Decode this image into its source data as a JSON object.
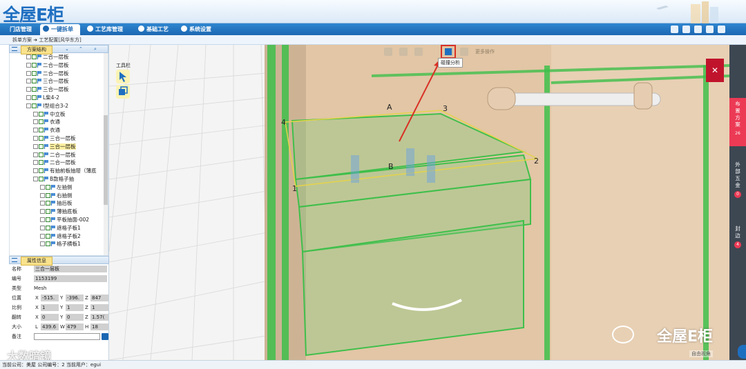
{
  "app": {
    "logo_text": "全屋E柜"
  },
  "nav": {
    "tabs": [
      {
        "label": "门店管理"
      },
      {
        "label": "一键拆单"
      },
      {
        "label": "工艺库管理"
      },
      {
        "label": "基础工艺"
      },
      {
        "label": "系统设置"
      }
    ],
    "active_index": 1
  },
  "breadcrumb": "拆单方案 ➜ 工艺配置[风华东方]",
  "tree_panel": {
    "title": "方案结构",
    "items": [
      {
        "label": "二合一层板",
        "depth": 1,
        "checked": true
      },
      {
        "label": "二合一层板",
        "depth": 1,
        "checked": true
      },
      {
        "label": "二合一层板",
        "depth": 1,
        "checked": true
      },
      {
        "label": "三合一层板",
        "depth": 1,
        "checked": true
      },
      {
        "label": "三合一层板",
        "depth": 1,
        "checked": true
      },
      {
        "label": "L柴4-2",
        "depth": 1,
        "checked": true
      },
      {
        "label": "I型组合3-2",
        "depth": 1,
        "checked": true
      },
      {
        "label": "中立板",
        "depth": 2,
        "checked": true
      },
      {
        "label": "衣通",
        "depth": 2,
        "checked": true
      },
      {
        "label": "衣通",
        "depth": 2,
        "checked": true
      },
      {
        "label": "三合一层板",
        "depth": 2,
        "checked": true
      },
      {
        "label": "三合一层板",
        "depth": 2,
        "checked": true,
        "selected": true
      },
      {
        "label": "二合一层板",
        "depth": 2,
        "checked": true
      },
      {
        "label": "二合一层板",
        "depth": 2,
        "checked": true
      },
      {
        "label": "有抽前板抽屉（薄底",
        "depth": 2,
        "checked": true
      },
      {
        "label": "B款格子抽",
        "depth": 2,
        "checked": true
      },
      {
        "label": "左抽侧",
        "depth": 3,
        "checked": true
      },
      {
        "label": "右抽侧",
        "depth": 3,
        "checked": true
      },
      {
        "label": "抽后板",
        "depth": 3,
        "checked": true
      },
      {
        "label": "薄抽底板",
        "depth": 3,
        "checked": true
      },
      {
        "label": "平板抽面-002",
        "depth": 3,
        "checked": true
      },
      {
        "label": "遮格子板1",
        "depth": 3,
        "checked": true
      },
      {
        "label": "遮格子板2",
        "depth": 3,
        "checked": true
      },
      {
        "label": "格子横板1",
        "depth": 3,
        "checked": true
      }
    ]
  },
  "properties": {
    "title": "属性信息",
    "name_label": "名称",
    "name_value": "三合一层板",
    "id_label": "编号",
    "id_value": "1153199",
    "type_label": "类型",
    "type_value": "Mesh",
    "position_label": "位置",
    "position": {
      "x": "-515.",
      "y": "-396.",
      "z": "847"
    },
    "scale_label": "比例",
    "scale": {
      "x": "1",
      "y": "1",
      "z": "1"
    },
    "rotation_label": "翻转",
    "rotation": {
      "x": "0",
      "y": "0",
      "z": "1.57("
    },
    "size_label": "大小",
    "size": {
      "l": "439.6",
      "w": "479",
      "h": "18"
    },
    "note_label": "备注"
  },
  "status_bar": "当前公司：美屋   公司编号：2    当前用户：egui",
  "watermark_left": "大数暗镜",
  "viewport": {
    "toolbox_label": "工具栏",
    "more_label": "更多操作",
    "collision_tooltip": "碰撞分析",
    "labels": [
      "A",
      "B",
      "1",
      "2",
      "3",
      "4"
    ],
    "view_label": "自由视角",
    "watermark": "全屋E柜"
  },
  "side_tabs": [
    {
      "label": "布置方案",
      "count": "26"
    },
    {
      "label": "外部五金",
      "count": "0"
    },
    {
      "label": "封边",
      "count": "4"
    }
  ]
}
